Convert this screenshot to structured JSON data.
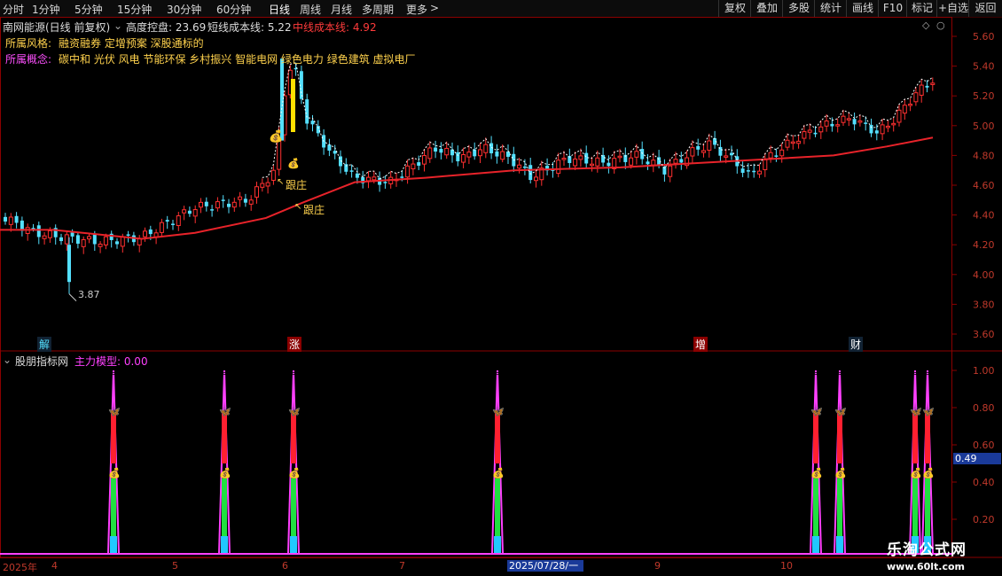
{
  "toolbar": {
    "left": [
      "分时",
      "1分钟",
      "5分钟",
      "15分钟",
      "30分钟",
      "60分钟",
      "日线",
      "周线",
      "月线",
      "多周期",
      "更多"
    ],
    "more_arrow": ">",
    "right": [
      "复权",
      "叠加",
      "多股",
      "统计",
      "画线",
      "F10",
      "标记",
      "+自选",
      "返回"
    ]
  },
  "header": {
    "stock": "南网能源(日线 前复权)",
    "ind1_label": "高度控盘: 23.69",
    "ind2_label": "短线成本线: 5.22",
    "ind3_label": "中线成本线: 4.92",
    "style_label": "所属风格:",
    "style_value": "融资融券 定增预案 深股通标的",
    "concept_label": "所属概念:",
    "concept_value": "碳中和 光伏 风电 节能环保 乡村振兴 智能电网 绿色电力 绿色建筑 虚拟电厂"
  },
  "annotations": {
    "low": "3.87",
    "follow1": "跟庄",
    "follow2": "跟庄",
    "markers": [
      "解",
      "涨",
      "增",
      "财"
    ]
  },
  "sub": {
    "name": "股朋指标网",
    "model": "主力模型: 0.00",
    "current": "0.49"
  },
  "price_axis": [
    "5.60",
    "5.40",
    "5.20",
    "5.00",
    "4.80",
    "4.60",
    "4.40",
    "4.20",
    "4.00",
    "3.80",
    "3.60"
  ],
  "sub_axis": [
    "1.00",
    "0.80",
    "0.60",
    "0.40",
    "0.20"
  ],
  "time_axis": [
    "2025年",
    "4",
    "5",
    "6",
    "7",
    "2025/07/28/一",
    "9",
    "10"
  ],
  "watermark": {
    "line1": "乐淘公式网",
    "line2": "www.60lt.com"
  },
  "colors": {
    "up": "#ff3030",
    "down": "#54e0ff",
    "ma": "#e8232a",
    "pink": "#ff40ff",
    "green": "#20e040",
    "yellow": "#ffe000"
  }
}
